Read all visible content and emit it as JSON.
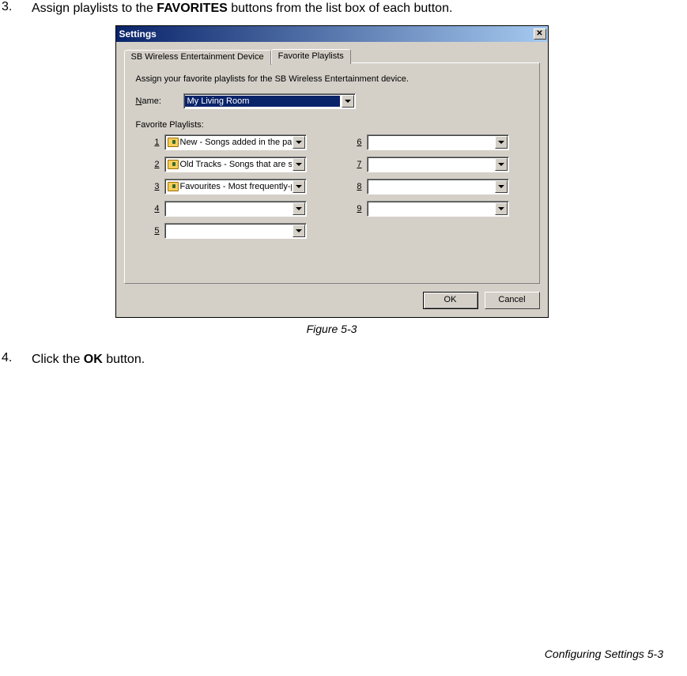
{
  "steps": {
    "s3_num": "3.",
    "s3_pre": "Assign playlists to the ",
    "s3_bold": "FAVORITES",
    "s3_post": " buttons from the list box of each button.",
    "s4_num": "4.",
    "s4_pre": "Click the ",
    "s4_bold": "OK",
    "s4_post": " button."
  },
  "dialog": {
    "title": "Settings",
    "tab_inactive": "SB Wireless Entertainment Device",
    "tab_active": "Favorite Playlists",
    "instruction": "Assign your favorite playlists for the SB Wireless Entertainment device.",
    "name_label_u": "N",
    "name_label_rest": "ame:",
    "name_value": "My Living Room",
    "fav_label": "Favorite Playlists:",
    "slots_left": [
      {
        "num": "1",
        "text": "New - Songs added in the past m",
        "icon": true
      },
      {
        "num": "2",
        "text": "Old Tracks - Songs that are seld",
        "icon": true
      },
      {
        "num": "3",
        "text": "Favourites - Most frequently-play",
        "icon": true
      },
      {
        "num": "4",
        "text": "",
        "icon": false
      },
      {
        "num": "5",
        "text": "",
        "icon": false
      }
    ],
    "slots_right": [
      {
        "num": "6",
        "text": "",
        "icon": false
      },
      {
        "num": "7",
        "text": "",
        "icon": false
      },
      {
        "num": "8",
        "text": "",
        "icon": false
      },
      {
        "num": "9",
        "text": "",
        "icon": false
      }
    ],
    "ok": "OK",
    "cancel": "Cancel"
  },
  "caption": "Figure 5-3",
  "footer": "Configuring Settings  5-3"
}
